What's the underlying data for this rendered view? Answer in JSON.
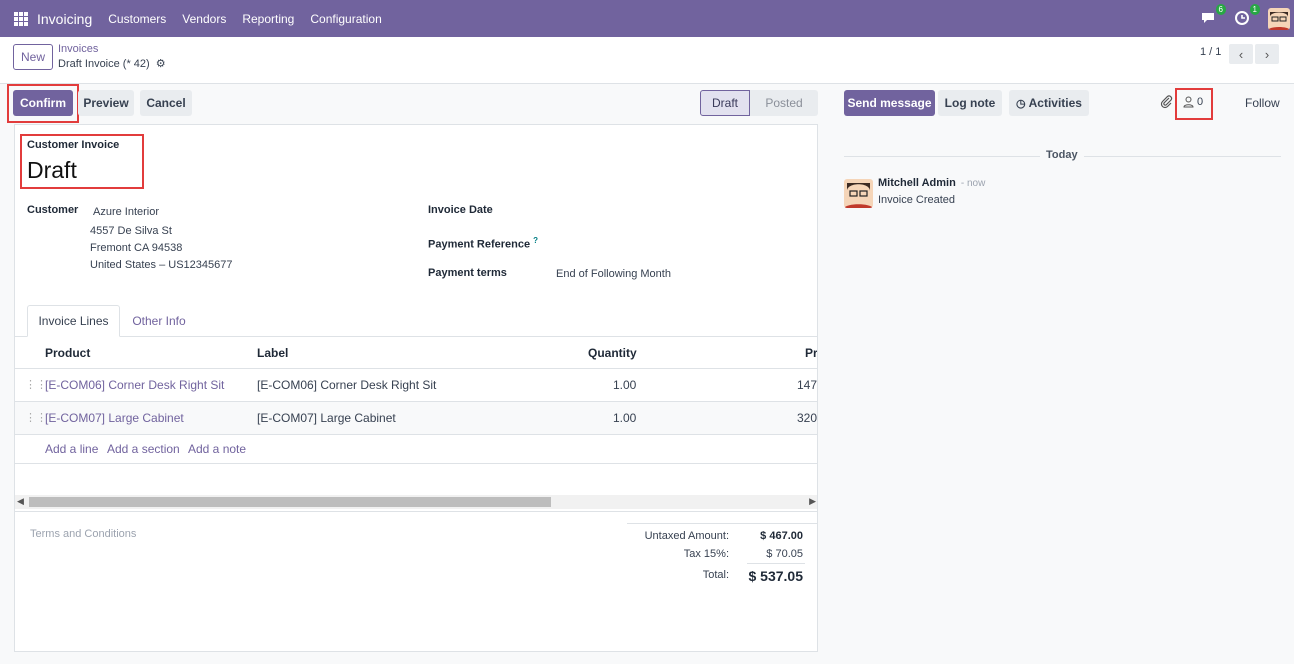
{
  "topbar": {
    "app_name": "Invoicing",
    "menu": [
      "Customers",
      "Vendors",
      "Reporting",
      "Configuration"
    ],
    "messages_badge": "6",
    "activities_badge": "1"
  },
  "control_panel": {
    "new_label": "New",
    "breadcrumb_parent": "Invoices",
    "breadcrumb_current": "Draft Invoice (* 42)",
    "pager": "1 / 1"
  },
  "actions": {
    "confirm": "Confirm",
    "preview": "Preview",
    "cancel": "Cancel"
  },
  "status": {
    "draft": "Draft",
    "posted": "Posted"
  },
  "form": {
    "type_label": "Customer Invoice",
    "state_title": "Draft",
    "customer_label": "Customer",
    "customer_name": "Azure Interior",
    "address_line1": "4557 De Silva St",
    "address_line2": "Fremont CA 94538",
    "address_line3": "United States – US12345677",
    "invoice_date_label": "Invoice Date",
    "payment_reference_label": "Payment Reference",
    "payment_reference_help": "?",
    "payment_terms_label": "Payment terms",
    "payment_terms_value": "End of Following Month"
  },
  "tabs": [
    "Invoice Lines",
    "Other Info"
  ],
  "lines_table": {
    "headers": [
      "Product",
      "Label",
      "Quantity",
      "Pr"
    ],
    "rows": [
      {
        "product": "[E-COM06] Corner Desk Right Sit",
        "label": "[E-COM06] Corner Desk Right Sit",
        "quantity": "1.00",
        "price": "147"
      },
      {
        "product": "[E-COM07] Large Cabinet",
        "label": "[E-COM07] Large Cabinet",
        "quantity": "1.00",
        "price": "320"
      }
    ],
    "add_line": "Add a line",
    "add_section": "Add a section",
    "add_note": "Add a note"
  },
  "terms_placeholder": "Terms and Conditions",
  "totals": {
    "untaxed_label": "Untaxed Amount:",
    "untaxed_value": "$ 467.00",
    "tax_label": "Tax 15%:",
    "tax_value": "$ 70.05",
    "total_label": "Total:",
    "total_value": "$ 537.05"
  },
  "chatter": {
    "send_message": "Send message",
    "log_note": "Log note",
    "activities": "Activities",
    "followers_count": "0",
    "follow": "Follow",
    "date_separator": "Today",
    "message_author": "Mitchell Admin",
    "message_time": "- now",
    "message_body": "Invoice Created"
  },
  "colors": {
    "brand": "#71639e",
    "badge": "#28a745",
    "highlight": "#e23c3c"
  }
}
